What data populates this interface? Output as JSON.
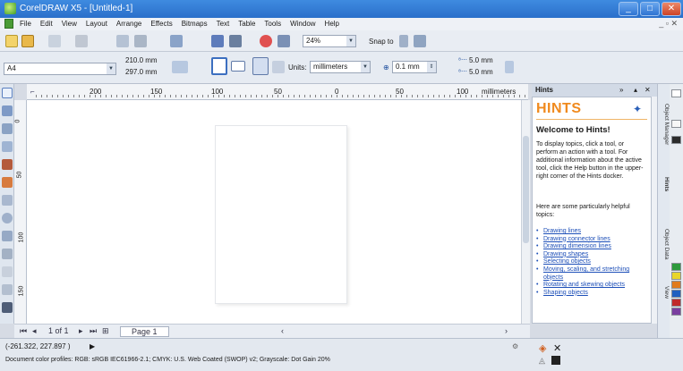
{
  "window": {
    "title": "CorelDRAW X5 - [Untitled-1]",
    "controls": [
      "_",
      "□",
      "✕"
    ]
  },
  "menubar": {
    "items": [
      "File",
      "Edit",
      "View",
      "Layout",
      "Arrange",
      "Effects",
      "Bitmaps",
      "Text",
      "Table",
      "Tools",
      "Window",
      "Help"
    ]
  },
  "standard_toolbar": {
    "zoom": "24%",
    "snap_to": "Snap to"
  },
  "property_bar": {
    "paper": "A4",
    "width": "210.0 mm",
    "height": "297.0 mm",
    "units_label": "Units:",
    "units_value": "millimeters",
    "nudge": "0.1 mm",
    "dup_x": "5.0 mm",
    "dup_y": "5.0 mm"
  },
  "ruler": {
    "ticks": [
      "200",
      "150",
      "100",
      "50",
      "0",
      "50",
      "100",
      "150"
    ],
    "unit": "millimeters"
  },
  "page_nav": {
    "count": "1 of 1",
    "page_tab": "Page 1"
  },
  "hints": {
    "docker_title": "Hints",
    "header": "HINTS",
    "welcome": "Welcome to Hints!",
    "para1": "To display topics, click a tool, or perform an action with a tool. For additional information about the active tool, click the Help button in the upper-right corner of the Hints docker.",
    "para2": "Here are some particularly helpful topics:",
    "links": [
      "Drawing lines",
      "Drawing connector lines",
      "Drawing dimension lines",
      "Drawing shapes",
      "Selecting objects",
      "Moving, scaling, and stretching objects",
      "Rotating and skewing objects",
      "Shaping objects"
    ]
  },
  "docker_tabs": [
    "Object Manager",
    "Hints",
    "Object Data",
    "View"
  ],
  "status": {
    "coords": "(-261.322, 227.897 )",
    "profile": "Document color profiles: RGB: sRGB IEC61966-2.1; CMYK: U.S. Web Coated (SWOP) v2; Grayscale: Dot Gain 20%"
  },
  "colors": {
    "title_bar": "#2a6fca",
    "hints_orange": "#f08a1e",
    "link_blue": "#1d4fb8"
  }
}
